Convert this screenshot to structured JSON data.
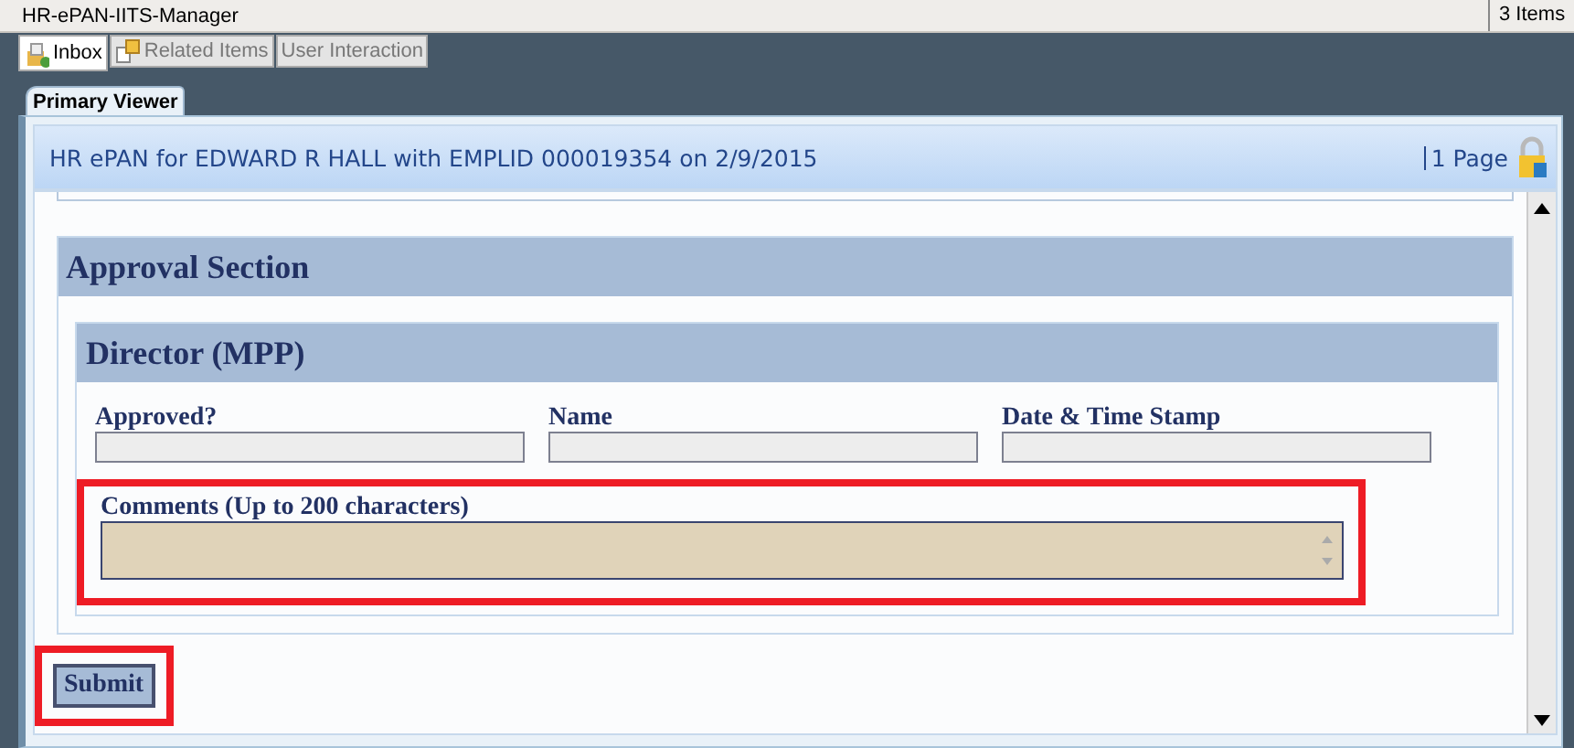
{
  "app": {
    "title": "HR-ePAN-IITS-Manager",
    "item_count": "3 Items"
  },
  "tabs": [
    {
      "label": "Inbox",
      "selected": true
    },
    {
      "label": "Related Items",
      "selected": false
    },
    {
      "label": "User Interaction",
      "selected": false
    }
  ],
  "viewer": {
    "tab": "Primary Viewer",
    "header": "HR ePAN for EDWARD R HALL with EMPLID 000019354 on 2/9/2015",
    "pages": "1 Page"
  },
  "section": {
    "title": "Approval Section",
    "subsection": "Director (MPP)",
    "fields": [
      {
        "label": "Approved?"
      },
      {
        "label": "Name"
      },
      {
        "label": "Date & Time Stamp"
      }
    ],
    "comments": {
      "label": "Comments (Up to 200 characters)",
      "highlighted": true
    }
  },
  "submit": {
    "label": "Submit",
    "highlighted": true
  }
}
